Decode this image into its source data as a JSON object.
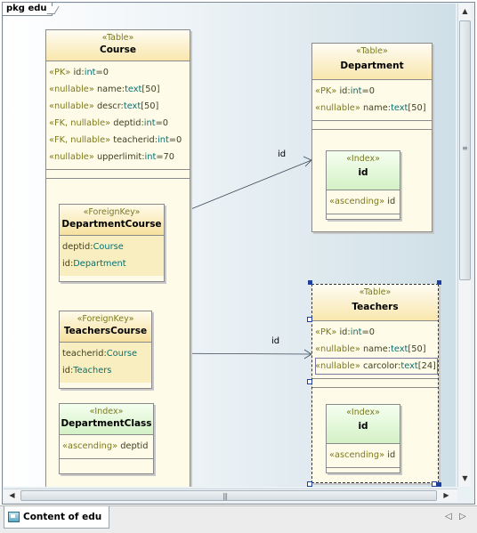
{
  "package_tab": "pkg edu",
  "bottom_tab": "Content of edu",
  "classes": {
    "course": {
      "stereotype": "«Table»",
      "name": "Course",
      "attrs": [
        {
          "st": "«PK»",
          "nm": "id",
          "ty": "int",
          "val": "=0"
        },
        {
          "st": "«nullable»",
          "nm": "name",
          "ty": "text",
          "val": "[50]"
        },
        {
          "st": "«nullable»",
          "nm": "descr",
          "ty": "text",
          "val": "[50]"
        },
        {
          "st": "«FK, nullable»",
          "nm": "deptid",
          "ty": "int",
          "val": "=0"
        },
        {
          "st": "«FK, nullable»",
          "nm": "teacherid",
          "ty": "int",
          "val": "=0"
        },
        {
          "st": "«nullable»",
          "nm": "upperlimit",
          "ty": "int",
          "val": "=70"
        }
      ]
    },
    "department": {
      "stereotype": "«Table»",
      "name": "Department",
      "attrs": [
        {
          "st": "«PK»",
          "nm": "id",
          "ty": "int",
          "val": "=0"
        },
        {
          "st": "«nullable»",
          "nm": "name",
          "ty": "text",
          "val": "[50]"
        }
      ]
    },
    "department_index": {
      "stereotype": "«Index»",
      "name": "id",
      "attr_st": "«ascending»",
      "attr_nm": "id"
    },
    "department_course": {
      "stereotype": "«ForeignKey»",
      "name": "DepartmentCourse",
      "attrs": [
        {
          "nm": "deptid",
          "ty": "Course"
        },
        {
          "nm": "id",
          "ty": "Department"
        }
      ]
    },
    "teachers_course": {
      "stereotype": "«ForeignKey»",
      "name": "TeachersCourse",
      "attrs": [
        {
          "nm": "teacherid",
          "ty": "Course"
        },
        {
          "nm": "id",
          "ty": "Teachers"
        }
      ]
    },
    "department_class": {
      "stereotype": "«Index»",
      "name": "DepartmentClass",
      "attr_st": "«ascending»",
      "attr_nm": "deptid"
    },
    "teachers": {
      "stereotype": "«Table»",
      "name": "Teachers",
      "attrs": [
        {
          "st": "«PK»",
          "nm": "id",
          "ty": "int",
          "val": "=0"
        },
        {
          "st": "«nullable»",
          "nm": "name",
          "ty": "text",
          "val": "[50]"
        },
        {
          "st": "«nullable»",
          "nm": "carcolor",
          "ty": "text",
          "val": "[24]"
        }
      ]
    },
    "teachers_index": {
      "stereotype": "«Index»",
      "name": "id",
      "attr_st": "«ascending»",
      "attr_nm": "id"
    }
  },
  "edges": {
    "dept_course_label": "id",
    "teachers_course_label": "id"
  },
  "icons": {
    "scroll_up": "▲",
    "scroll_down": "▼",
    "scroll_left": "◀",
    "scroll_right": "▶",
    "grip_v": "≡",
    "grip_h": "|||",
    "tab_prev": "◁",
    "tab_next": "▷"
  },
  "colors": {
    "table_header": "#f9e7ad",
    "index_header": "#d4f1c6",
    "stereotype_text": "#7d7a1c",
    "type_text": "#087070"
  }
}
